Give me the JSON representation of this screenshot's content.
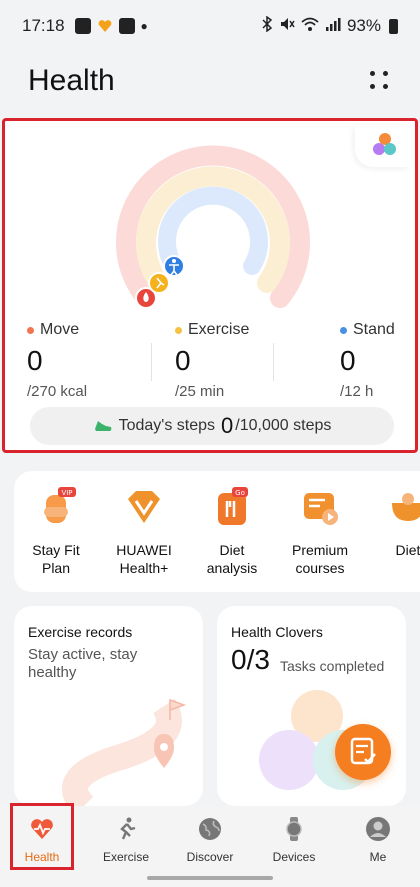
{
  "status_bar": {
    "time": "17:18",
    "battery": "93%"
  },
  "header": {
    "title": "Health"
  },
  "rings": {
    "move": {
      "label": "Move",
      "value": "0",
      "unit": "/270 kcal",
      "color": "#f27551"
    },
    "exercise": {
      "label": "Exercise",
      "value": "0",
      "unit": "/25 min",
      "color": "#f5c242"
    },
    "stand": {
      "label": "Stand",
      "value": "0",
      "unit": "/12 h",
      "color": "#4a8fe6"
    }
  },
  "steps": {
    "label": "Today's steps",
    "value": "0",
    "goal": "/10,000 steps"
  },
  "services": [
    {
      "label_line1": "Stay Fit",
      "label_line2": "Plan",
      "icon": "stay-fit-icon"
    },
    {
      "label_line1": "HUAWEI",
      "label_line2": "Health+",
      "icon": "huawei-health-plus-icon"
    },
    {
      "label_line1": "Diet",
      "label_line2": "analysis",
      "icon": "diet-analysis-icon"
    },
    {
      "label_line1": "Premium",
      "label_line2": "courses",
      "icon": "premium-courses-icon"
    },
    {
      "label_line1": "Diet",
      "label_line2": "",
      "icon": "diet-icon"
    }
  ],
  "exercise_records": {
    "title": "Exercise records",
    "subtitle": "Stay active, stay healthy"
  },
  "health_clovers": {
    "title": "Health Clovers",
    "count": "0/3",
    "tasks_label": "Tasks completed"
  },
  "tabs": [
    {
      "label": "Health",
      "active": true
    },
    {
      "label": "Exercise",
      "active": false
    },
    {
      "label": "Discover",
      "active": false
    },
    {
      "label": "Devices",
      "active": false
    },
    {
      "label": "Me",
      "active": false
    }
  ],
  "colors": {
    "accent": "#e56b14",
    "highlight": "#d9232d"
  }
}
